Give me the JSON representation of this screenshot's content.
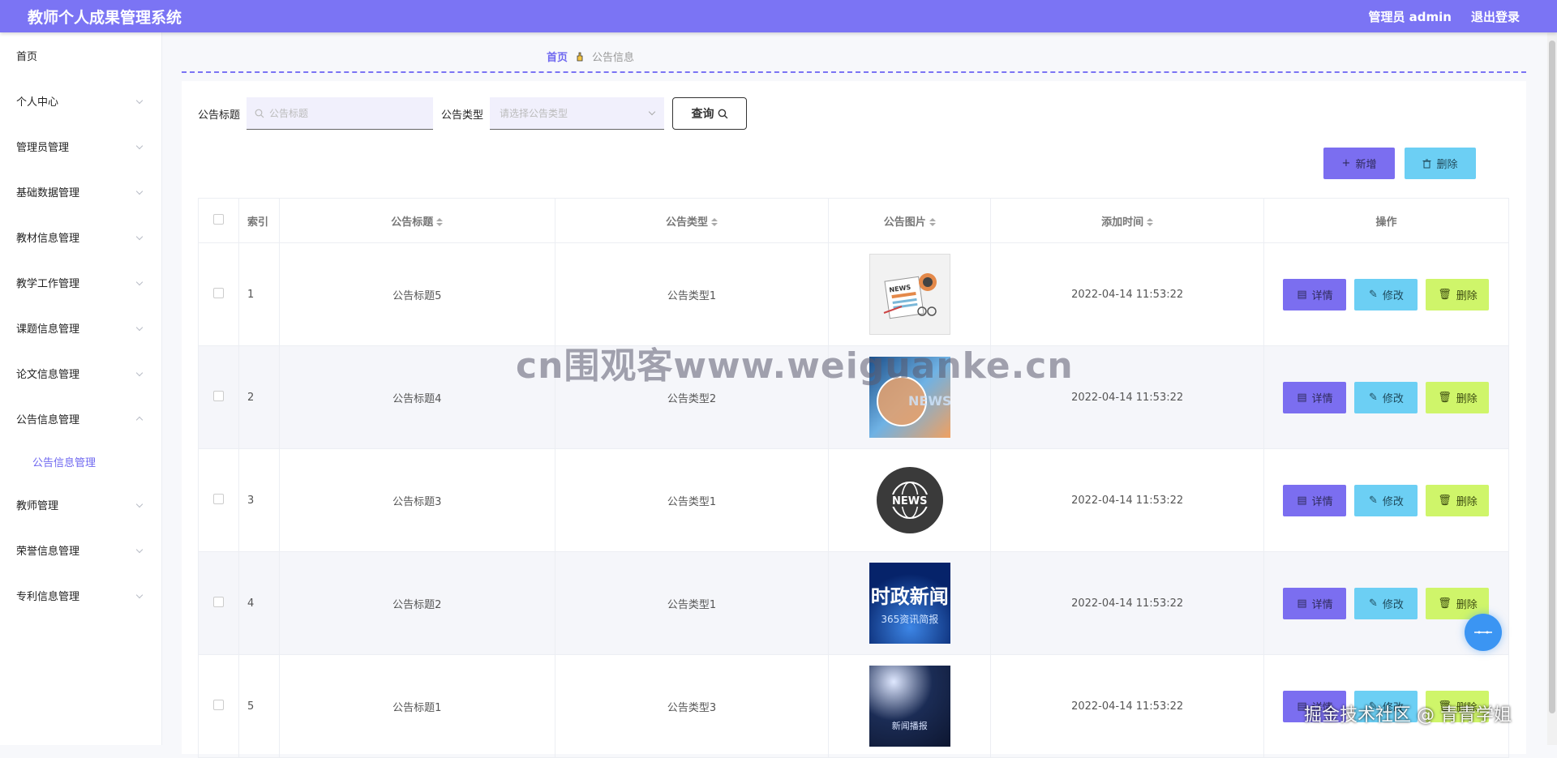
{
  "app": {
    "title": "教师个人成果管理系统",
    "user_label": "管理员 admin",
    "logout_label": "退出登录"
  },
  "sidebar": {
    "items": [
      {
        "label": "首页",
        "has_chevron": false
      },
      {
        "label": "个人中心",
        "has_chevron": true
      },
      {
        "label": "管理员管理",
        "has_chevron": true
      },
      {
        "label": "基础数据管理",
        "has_chevron": true
      },
      {
        "label": "教材信息管理",
        "has_chevron": true
      },
      {
        "label": "教学工作管理",
        "has_chevron": true
      },
      {
        "label": "课题信息管理",
        "has_chevron": true
      },
      {
        "label": "论文信息管理",
        "has_chevron": true
      },
      {
        "label": "公告信息管理",
        "has_chevron": true,
        "expanded": true
      },
      {
        "label": "教师管理",
        "has_chevron": true
      },
      {
        "label": "荣誉信息管理",
        "has_chevron": true
      },
      {
        "label": "专利信息管理",
        "has_chevron": true
      }
    ],
    "active_sub": "公告信息管理"
  },
  "breadcrumb": {
    "home": "首页",
    "current": "公告信息"
  },
  "search": {
    "title_label": "公告标题",
    "title_placeholder": "公告标题",
    "type_label": "公告类型",
    "type_placeholder": "请选择公告类型",
    "query_label": "查询"
  },
  "actions": {
    "add_label": "新增",
    "delete_label": "删除"
  },
  "table": {
    "headers": {
      "index": "索引",
      "title": "公告标题",
      "type": "公告类型",
      "image": "公告图片",
      "time": "添加时间",
      "ops": "操作"
    },
    "rows": [
      {
        "index": "1",
        "title": "公告标题5",
        "type": "公告类型1",
        "image": "news-paper-icon",
        "time": "2022-04-14 11:53:22"
      },
      {
        "index": "2",
        "title": "公告标题4",
        "type": "公告类型2",
        "image": "news-globe-blue",
        "time": "2022-04-14 11:53:22"
      },
      {
        "index": "3",
        "title": "公告标题3",
        "type": "公告类型1",
        "image": "news-globe-badge",
        "time": "2022-04-14 11:53:22"
      },
      {
        "index": "4",
        "title": "公告标题2",
        "type": "公告类型1",
        "image": "shizheng-xinwen",
        "time": "2022-04-14 11:53:22"
      },
      {
        "index": "5",
        "title": "公告标题1",
        "type": "公告类型3",
        "image": "news-stage-spotlight",
        "time": "2022-04-14 11:53:22"
      }
    ],
    "op_labels": {
      "detail": "详情",
      "edit": "修改",
      "delete": "删除"
    }
  },
  "images": {
    "img4_text": "时政新闻",
    "img4_sub": "365资讯简报",
    "img5_text": "新闻播报",
    "img2_text": "NEWS",
    "img3_text": "NEWS",
    "img1_text": "NEWS"
  },
  "watermark": {
    "center": "cn围观客www.weiguanke.cn",
    "corner": "掘金技术社区 @ 青青学姐"
  },
  "colors": {
    "primary": "#7b74f4",
    "info": "#6ccff4",
    "lime": "#cff56a"
  }
}
